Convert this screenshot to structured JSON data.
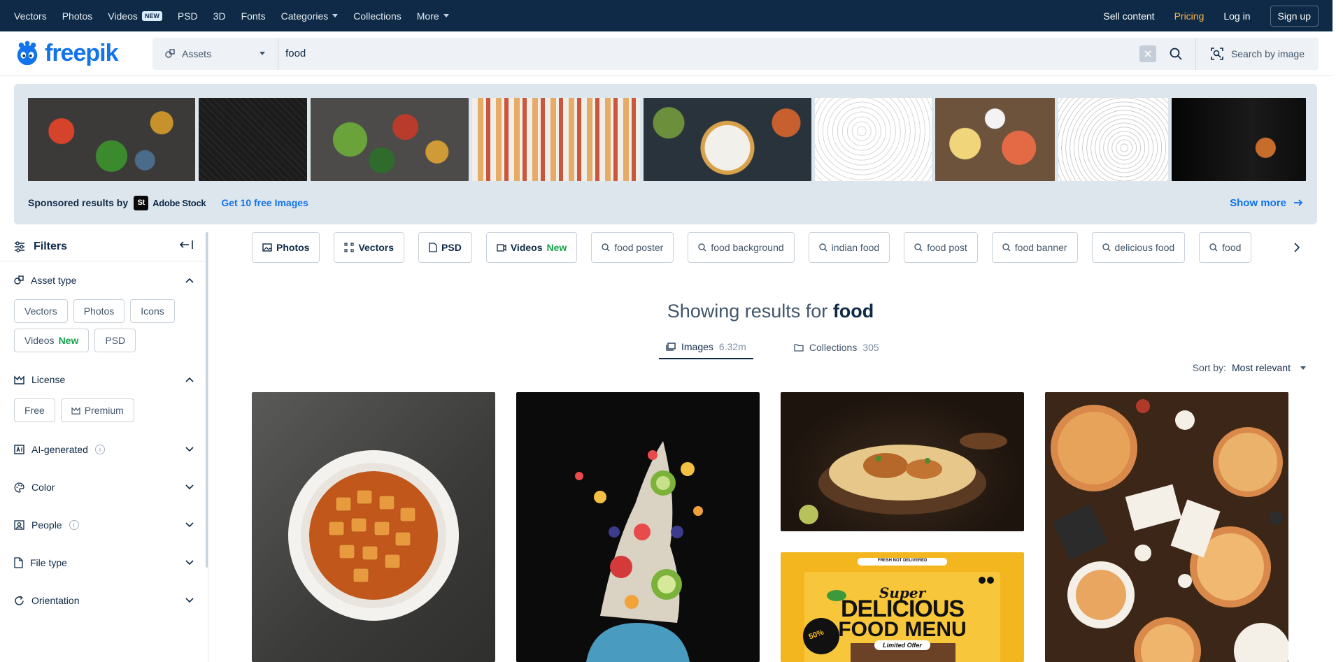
{
  "topnav": {
    "items": [
      {
        "label": "Vectors"
      },
      {
        "label": "Photos"
      },
      {
        "label": "Videos",
        "badge": "NEW"
      },
      {
        "label": "PSD"
      },
      {
        "label": "3D"
      },
      {
        "label": "Fonts"
      },
      {
        "label": "Categories"
      },
      {
        "label": "Collections"
      },
      {
        "label": "More"
      }
    ],
    "sell": "Sell content",
    "pricing": "Pricing",
    "login": "Log in",
    "signup": "Sign up"
  },
  "header": {
    "logo": "freepik",
    "asset_select": "Assets",
    "search_value": "food",
    "search_by_image": "Search by image"
  },
  "sponsored": {
    "label": "Sponsored results by",
    "provider": "Adobe Stock",
    "provider_mark": "St",
    "free_link": "Get 10 free Images",
    "show_more": "Show more"
  },
  "filters": {
    "title": "Filters",
    "asset_type": {
      "title": "Asset type",
      "chips": [
        "Vectors",
        "Photos",
        "Icons",
        "Videos",
        "PSD"
      ],
      "new_label": "New"
    },
    "license": {
      "title": "License",
      "chips": [
        "Free",
        "Premium"
      ]
    },
    "ai_generated": "AI-generated",
    "color": "Color",
    "people": "People",
    "file_type": "File type",
    "orientation": "Orientation"
  },
  "tags": {
    "types": [
      "Photos",
      "Vectors",
      "PSD",
      "Videos"
    ],
    "new_label": "New",
    "queries": [
      "food poster",
      "food background",
      "indian food",
      "food post",
      "food banner",
      "delicious food",
      "food"
    ]
  },
  "results": {
    "prefix": "Showing results for",
    "query": "food",
    "tabs": [
      {
        "label": "Images",
        "count": "6.32m"
      },
      {
        "label": "Collections",
        "count": "305"
      }
    ],
    "sort_label": "Sort by:",
    "sort_value": "Most relevant"
  },
  "poster": {
    "top_tag": "FRESH NOT DELIVERED",
    "line1": "Super",
    "line2": "DELICIOUS",
    "line3": "FOOD MENU",
    "ribbon": "Limited Offer",
    "discount": "50%"
  },
  "colors": {
    "nav_bg": "#0e2a47",
    "brand_blue": "#1273eb",
    "pricing": "#ffb547",
    "new_green": "#16a34a"
  }
}
